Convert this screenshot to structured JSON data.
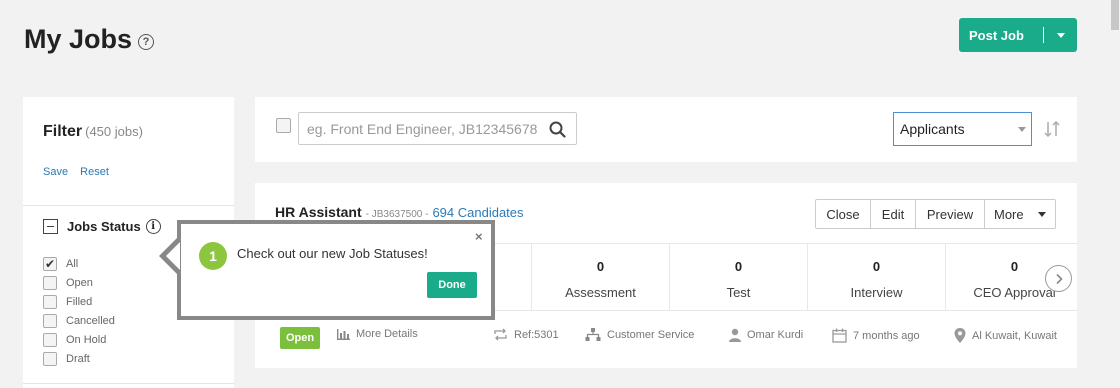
{
  "header": {
    "title": "My Jobs",
    "help_glyph": "?",
    "post_job_label": "Post Job"
  },
  "filter": {
    "title": "Filter",
    "count": "(450 jobs)",
    "save_label": "Save",
    "reset_label": "Reset",
    "jobs_status_label": "Jobs Status",
    "info_glyph": "i",
    "statuses": [
      {
        "label": "All",
        "checked": true
      },
      {
        "label": "Open",
        "checked": false
      },
      {
        "label": "Filled",
        "checked": false
      },
      {
        "label": "Cancelled",
        "checked": false
      },
      {
        "label": "On Hold",
        "checked": false
      },
      {
        "label": "Draft",
        "checked": false
      }
    ]
  },
  "search": {
    "placeholder": "eg. Front End Engineer, JB12345678",
    "value": "",
    "sort_selected": "Applicants"
  },
  "job": {
    "title": "HR Assistant",
    "id_text": "- JB3637500 -",
    "candidates": "694 Candidates",
    "actions": {
      "close": "Close",
      "edit": "Edit",
      "preview": "Preview",
      "more": "More"
    },
    "stages": [
      {
        "count": "0",
        "label": "Assessment"
      },
      {
        "count": "0",
        "label": "Test"
      },
      {
        "count": "0",
        "label": "Interview"
      },
      {
        "count": "0",
        "label": "CEO Approval"
      }
    ],
    "status_badge": "Open",
    "footer": {
      "more_details": "More Details",
      "ref": "Ref:5301",
      "department": "Customer Service",
      "owner": "Omar Kurdi",
      "posted": "7 months ago",
      "location": "Al Kuwait, Kuwait"
    }
  },
  "tooltip": {
    "step": "1",
    "message": "Check out our new Job Statuses!",
    "close_glyph": "×",
    "done_label": "Done"
  },
  "colors": {
    "accent": "#1aab8a",
    "link": "#2a7ab8",
    "open_badge": "#7bbf3c",
    "step_badge": "#8cc63f"
  }
}
